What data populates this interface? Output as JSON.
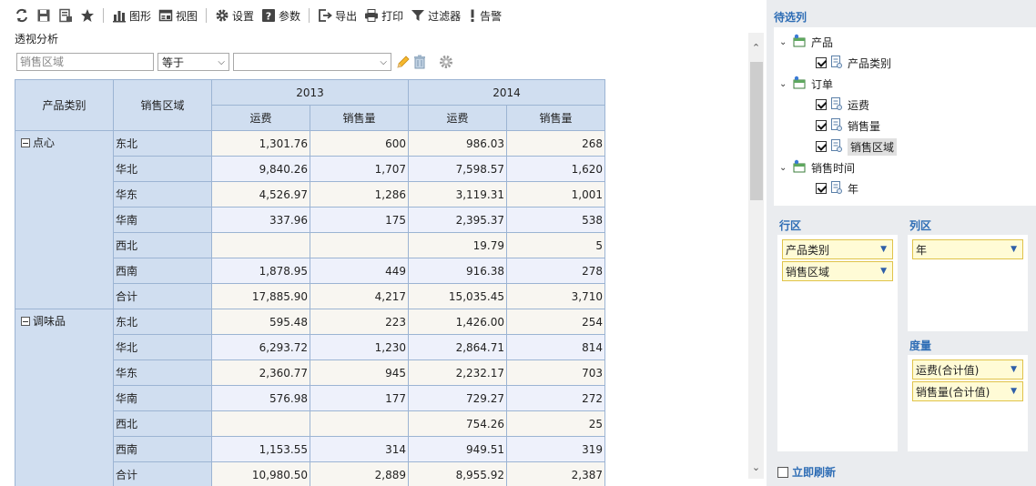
{
  "toolbar": {
    "items": [
      {
        "icon": "refresh-icon",
        "label": ""
      },
      {
        "icon": "save-icon",
        "label": ""
      },
      {
        "icon": "save-as-icon",
        "label": ""
      },
      {
        "icon": "star-icon",
        "label": ""
      },
      {
        "icon": "chart-icon",
        "label": "图形"
      },
      {
        "icon": "view-icon",
        "label": "视图"
      },
      {
        "icon": "gear-icon",
        "label": "设置"
      },
      {
        "icon": "param-icon",
        "label": "参数"
      },
      {
        "icon": "export-icon",
        "label": "导出"
      },
      {
        "icon": "print-icon",
        "label": "打印"
      },
      {
        "icon": "filter-icon",
        "label": "过滤器"
      },
      {
        "icon": "alert-icon",
        "label": "告警"
      }
    ]
  },
  "title": "透视分析",
  "filter": {
    "field_placeholder": "销售区域",
    "operator": "等于",
    "value": ""
  },
  "table": {
    "row_headers": [
      "产品类别",
      "销售区域"
    ],
    "years": [
      "2013",
      "2014"
    ],
    "measures": [
      "运费",
      "销售量"
    ],
    "groups": [
      {
        "name": "点心",
        "rows": [
          {
            "region": "东北",
            "v": [
              "1,301.76",
              "600",
              "986.03",
              "268"
            ]
          },
          {
            "region": "华北",
            "v": [
              "9,840.26",
              "1,707",
              "7,598.57",
              "1,620"
            ]
          },
          {
            "region": "华东",
            "v": [
              "4,526.97",
              "1,286",
              "3,119.31",
              "1,001"
            ]
          },
          {
            "region": "华南",
            "v": [
              "337.96",
              "175",
              "2,395.37",
              "538"
            ]
          },
          {
            "region": "西北",
            "v": [
              "",
              "",
              "19.79",
              "5"
            ]
          },
          {
            "region": "西南",
            "v": [
              "1,878.95",
              "449",
              "916.38",
              "278"
            ]
          },
          {
            "region": "合计",
            "v": [
              "17,885.90",
              "4,217",
              "15,035.45",
              "3,710"
            ]
          }
        ]
      },
      {
        "name": "调味品",
        "rows": [
          {
            "region": "东北",
            "v": [
              "595.48",
              "223",
              "1,426.00",
              "254"
            ]
          },
          {
            "region": "华北",
            "v": [
              "6,293.72",
              "1,230",
              "2,864.71",
              "814"
            ]
          },
          {
            "region": "华东",
            "v": [
              "2,360.77",
              "945",
              "2,232.17",
              "703"
            ]
          },
          {
            "region": "华南",
            "v": [
              "576.98",
              "177",
              "729.27",
              "272"
            ]
          },
          {
            "region": "西北",
            "v": [
              "",
              "",
              "754.26",
              "25"
            ]
          },
          {
            "region": "西南",
            "v": [
              "1,153.55",
              "314",
              "949.51",
              "319"
            ]
          },
          {
            "region": "合计",
            "v": [
              "10,980.50",
              "2,889",
              "8,955.92",
              "2,387"
            ]
          }
        ]
      }
    ]
  },
  "panel": {
    "pending_title": "待选列",
    "tree": [
      {
        "name": "产品",
        "children": [
          {
            "name": "产品类别",
            "checked": true
          }
        ]
      },
      {
        "name": "订单",
        "children": [
          {
            "name": "运费",
            "checked": true
          },
          {
            "name": "销售量",
            "checked": true
          },
          {
            "name": "销售区域",
            "checked": true
          }
        ]
      },
      {
        "name": "销售时间",
        "children": [
          {
            "name": "年",
            "checked": true
          }
        ]
      }
    ],
    "row_zone_title": "行区",
    "col_zone_title": "列区",
    "measure_zone_title": "度量",
    "row_fields": [
      "产品类别",
      "销售区域"
    ],
    "col_fields": [
      "年"
    ],
    "measure_fields": [
      "运费(合计值)",
      "销售量(合计值)"
    ],
    "refresh_label": "立即刷新"
  }
}
